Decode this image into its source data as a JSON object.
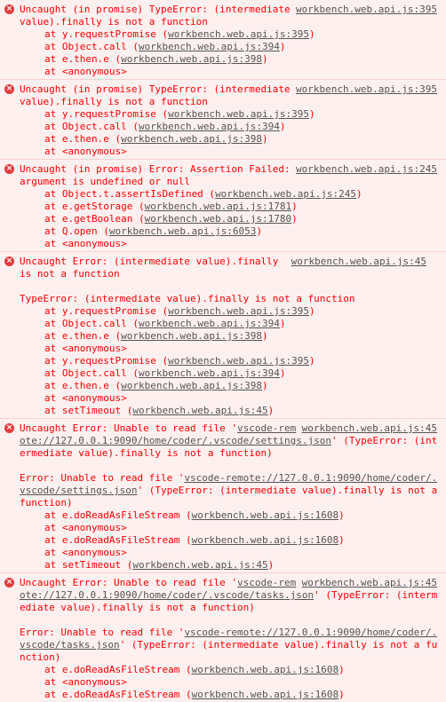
{
  "messages": [
    {
      "source": "workbench.web.api.js:395",
      "text": "Uncaught (in promise) TypeError: (intermediate value).finally is not a function",
      "frames": [
        {
          "pre": "at y.requestPromise (",
          "loc": "workbench.web.api.js:395",
          "post": ")"
        },
        {
          "pre": "at Object.call (",
          "loc": "workbench.web.api.js:394",
          "post": ")"
        },
        {
          "pre": "at e.then.e (",
          "loc": "workbench.web.api.js:398",
          "post": ")"
        },
        {
          "pre": "at <anonymous>",
          "loc": "",
          "post": ""
        }
      ]
    },
    {
      "source": "workbench.web.api.js:395",
      "text": "Uncaught (in promise) TypeError: (intermediate value).finally is not a function",
      "frames": [
        {
          "pre": "at y.requestPromise (",
          "loc": "workbench.web.api.js:395",
          "post": ")"
        },
        {
          "pre": "at Object.call (",
          "loc": "workbench.web.api.js:394",
          "post": ")"
        },
        {
          "pre": "at e.then.e (",
          "loc": "workbench.web.api.js:398",
          "post": ")"
        },
        {
          "pre": "at <anonymous>",
          "loc": "",
          "post": ""
        }
      ]
    },
    {
      "source": "workbench.web.api.js:245",
      "text": "Uncaught (in promise) Error: Assertion Failed: argument is undefined or null",
      "frames": [
        {
          "pre": "at Object.t.assertIsDefined (",
          "loc": "workbench.web.api.js:245",
          "post": ")"
        },
        {
          "pre": "at e.getStorage (",
          "loc": "workbench.web.api.js:1781",
          "post": ")"
        },
        {
          "pre": "at e.getBoolean (",
          "loc": "workbench.web.api.js:1780",
          "post": ")"
        },
        {
          "pre": "at Q.open (",
          "loc": "workbench.web.api.js:6053",
          "post": ")"
        },
        {
          "pre": "at <anonymous>",
          "loc": "",
          "post": ""
        }
      ]
    },
    {
      "source": "workbench.web.api.js:45",
      "text": "Uncaught Error: (intermediate value).finally is not a function",
      "subtext": "TypeError: (intermediate value).finally is not a function",
      "frames": [
        {
          "pre": "at y.requestPromise (",
          "loc": "workbench.web.api.js:395",
          "post": ")"
        },
        {
          "pre": "at Object.call (",
          "loc": "workbench.web.api.js:394",
          "post": ")"
        },
        {
          "pre": "at e.then.e (",
          "loc": "workbench.web.api.js:398",
          "post": ")"
        },
        {
          "pre": "at <anonymous>",
          "loc": "",
          "post": ""
        },
        {
          "pre": "at y.requestPromise (",
          "loc": "workbench.web.api.js:395",
          "post": ")"
        },
        {
          "pre": "at Object.call (",
          "loc": "workbench.web.api.js:394",
          "post": ")"
        },
        {
          "pre": "at e.then.e (",
          "loc": "workbench.web.api.js:398",
          "post": ")"
        },
        {
          "pre": "at <anonymous>",
          "loc": "",
          "post": ""
        },
        {
          "pre": "at setTimeout (",
          "loc": "workbench.web.api.js:45",
          "post": ")"
        }
      ]
    },
    {
      "source": "workbench.web.api.js:45",
      "text_pre": "Uncaught Error: Unable to read file '",
      "text_link": "vscode-remote://127.0.0.1:9090/home/coder/.vscode/settings.json",
      "text_post": "' (TypeError: (intermediate value).finally is not a function)",
      "sub_pre": "Error: Unable to read file '",
      "sub_link": "vscode-remote://127.0.0.1:9090/home/coder/.vscode/settings.json",
      "sub_post": "' (TypeError: (intermediate value).finally is not a function)",
      "frames": [
        {
          "pre": "at e.doReadAsFileStream (",
          "loc": "workbench.web.api.js:1608",
          "post": ")"
        },
        {
          "pre": "at <anonymous>",
          "loc": "",
          "post": ""
        },
        {
          "pre": "at e.doReadAsFileStream (",
          "loc": "workbench.web.api.js:1608",
          "post": ")"
        },
        {
          "pre": "at <anonymous>",
          "loc": "",
          "post": ""
        },
        {
          "pre": "at setTimeout (",
          "loc": "workbench.web.api.js:45",
          "post": ")"
        }
      ]
    },
    {
      "source": "workbench.web.api.js:45",
      "text_pre": "Uncaught Error: Unable to read file '",
      "text_link": "vscode-remote://127.0.0.1:9090/home/coder/.vscode/tasks.json",
      "text_post": "' (TypeError: (intermediate value).finally is not a function)",
      "sub_pre": "Error: Unable to read file '",
      "sub_link": "vscode-remote://127.0.0.1:9090/home/coder/.vscode/tasks.json",
      "sub_post": "' (TypeError: (intermediate value).finally is not a function)",
      "frames": [
        {
          "pre": "at e.doReadAsFileStream (",
          "loc": "workbench.web.api.js:1608",
          "post": ")"
        },
        {
          "pre": "at <anonymous>",
          "loc": "",
          "post": ""
        },
        {
          "pre": "at e.doReadAsFileStream (",
          "loc": "workbench.web.api.js:1608",
          "post": ")"
        }
      ]
    }
  ],
  "icons": {
    "error": "error-circle-icon",
    "error_color": "#e13c3c"
  },
  "colors": {
    "text": "#fe0000",
    "background": "#fff0f0",
    "link": "#545454"
  }
}
